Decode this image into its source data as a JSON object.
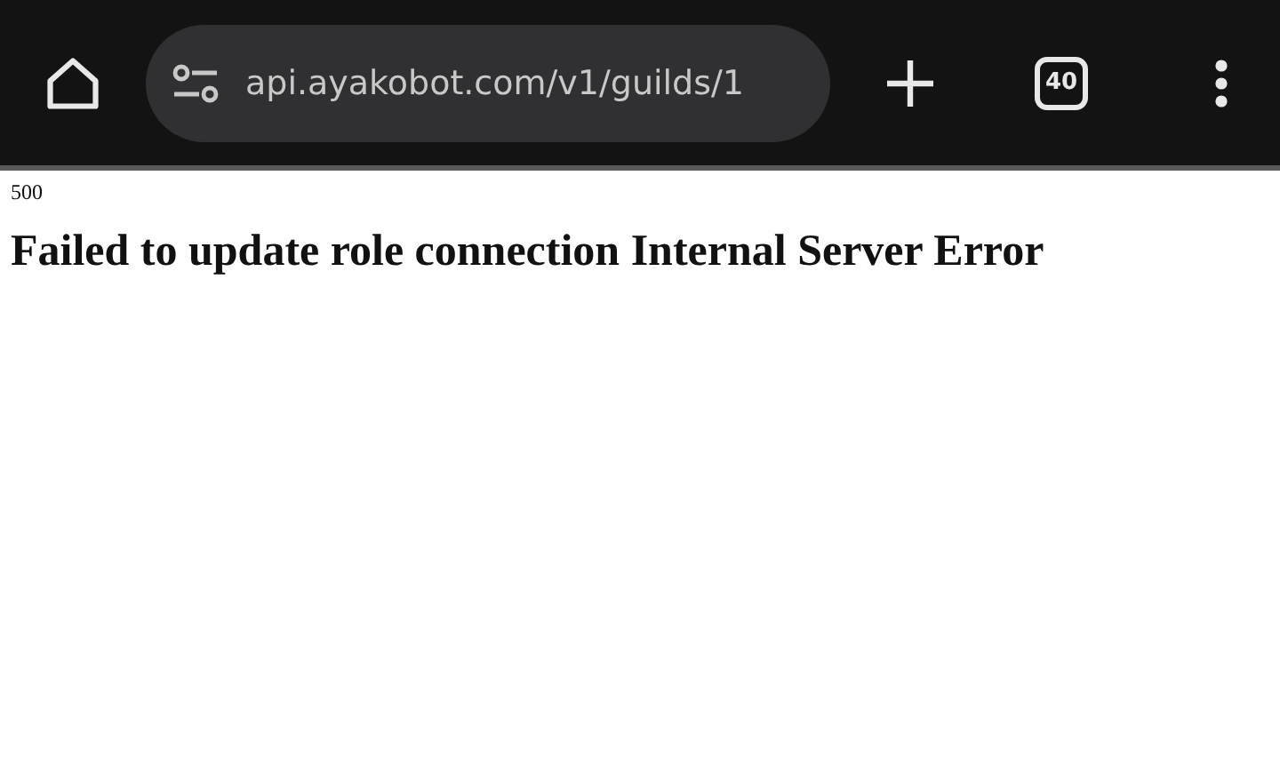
{
  "toolbar": {
    "url": "api.ayakobot.com/v1/guilds/1",
    "tab_count": "40"
  },
  "page": {
    "status": "500",
    "heading": "Failed to update role connection Internal Server Error"
  }
}
